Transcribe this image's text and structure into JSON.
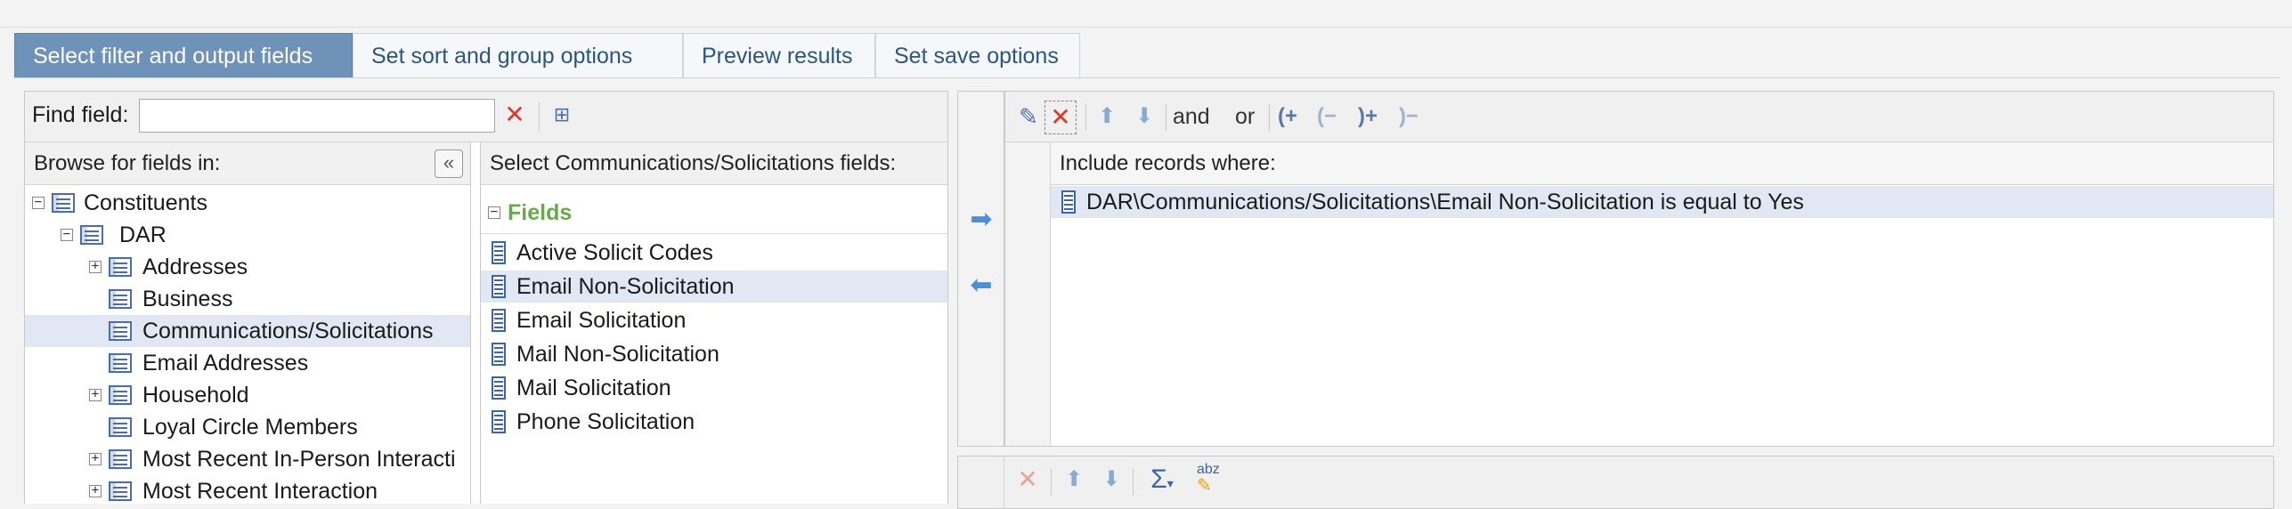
{
  "tabs": [
    {
      "label": "Select filter and output fields",
      "active": true
    },
    {
      "label": "Set sort and group options",
      "active": false
    },
    {
      "label": "Preview results",
      "active": false
    },
    {
      "label": "Set save options",
      "active": false
    }
  ],
  "find": {
    "label": "Find field:",
    "value": ""
  },
  "browse": {
    "header": "Browse for fields in:",
    "tree": [
      {
        "label": "Constituents",
        "level": 0,
        "expander": "minus"
      },
      {
        "label": "DAR",
        "level": 1,
        "expander": "minus"
      },
      {
        "label": "Addresses",
        "level": 2,
        "expander": "plus"
      },
      {
        "label": "Business",
        "level": 2,
        "expander": "none"
      },
      {
        "label": "Communications/Solicitations",
        "level": 2,
        "expander": "none",
        "selected": true
      },
      {
        "label": "Email Addresses",
        "level": 2,
        "expander": "none"
      },
      {
        "label": "Household",
        "level": 2,
        "expander": "plus"
      },
      {
        "label": "Loyal Circle Members",
        "level": 2,
        "expander": "none"
      },
      {
        "label": "Most Recent In-Person Interacti",
        "level": 2,
        "expander": "plus"
      },
      {
        "label": "Most Recent Interaction",
        "level": 2,
        "expander": "plus"
      }
    ]
  },
  "fields": {
    "header": "Select Communications/Solicitations fields:",
    "group": "Fields",
    "items": [
      {
        "label": "Active Solicit Codes"
      },
      {
        "label": "Email Non-Solicitation",
        "selected": true
      },
      {
        "label": "Email Solicitation"
      },
      {
        "label": "Mail Non-Solicitation"
      },
      {
        "label": "Mail Solicitation"
      },
      {
        "label": "Phone Solicitation"
      }
    ]
  },
  "filter": {
    "and_label": "and",
    "or_label": "or",
    "header": "Include records where:",
    "criteria": [
      "DAR\\Communications/Solicitations\\Email Non-Solicitation is equal to Yes"
    ]
  },
  "output": {
    "sum_label": "Σ",
    "abz_label": "abz"
  },
  "colors": {
    "active_tab": "#6f92b9",
    "link_blue": "#2a5680",
    "group_green": "#6aa84f",
    "delete_red": "#d93a2b",
    "selected_row": "#e1e8f3"
  }
}
